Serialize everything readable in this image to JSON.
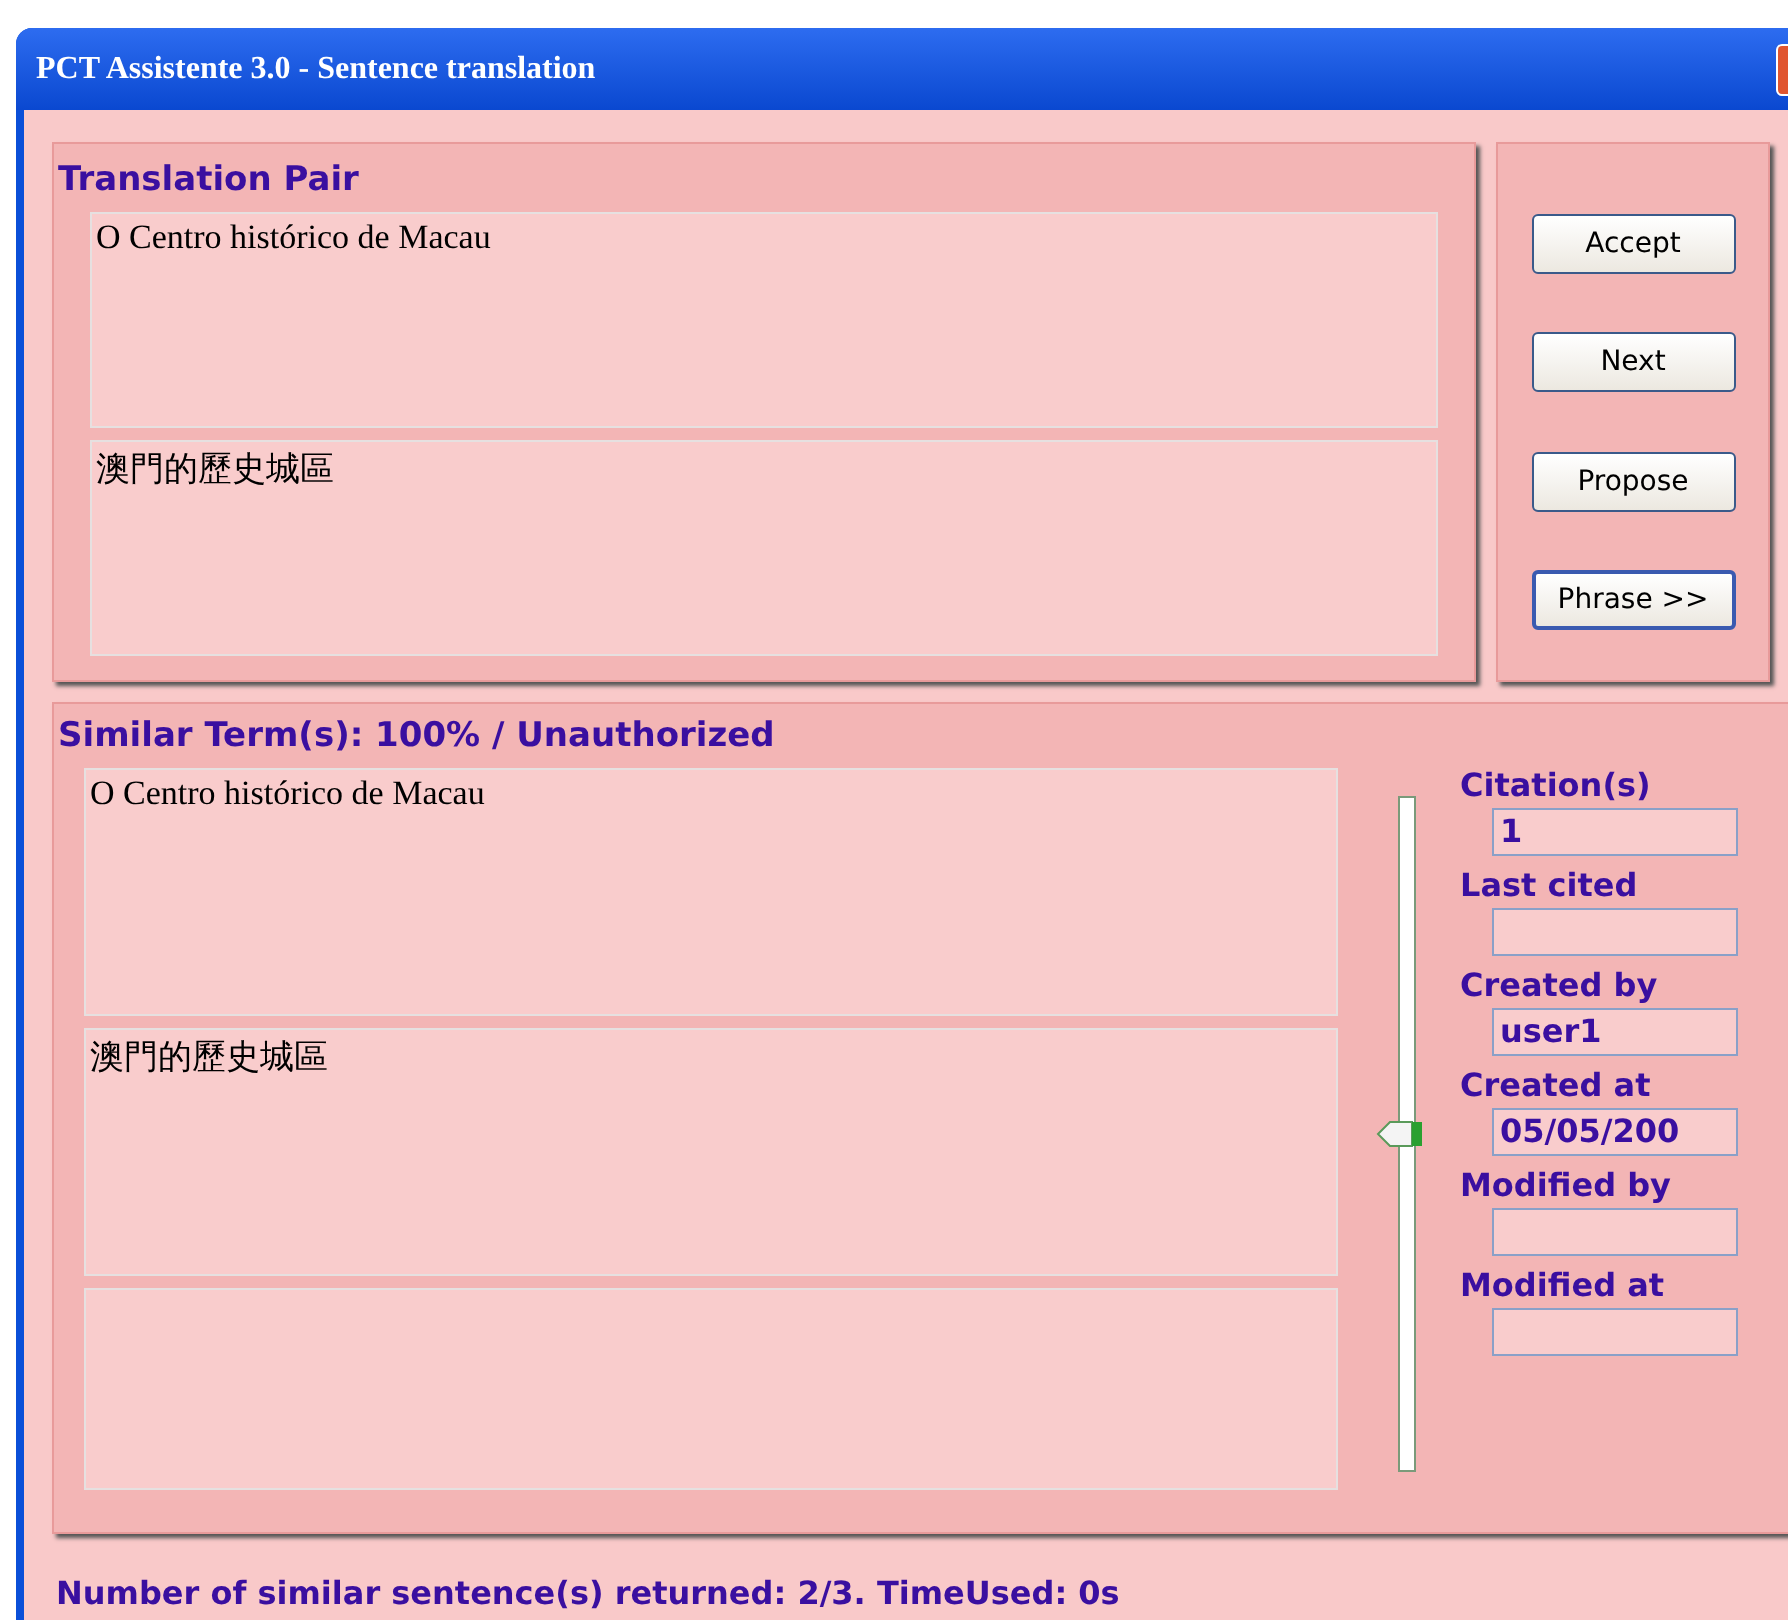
{
  "window": {
    "title": "PCT Assistente 3.0 - Sentence translation"
  },
  "translation_pair": {
    "heading": "Translation Pair",
    "source": "O Centro histórico de Macau",
    "target": "澳門的歷史城區"
  },
  "buttons": [
    {
      "label": "Accept",
      "default": false
    },
    {
      "label": "Next",
      "default": false
    },
    {
      "label": "Propose",
      "default": false
    },
    {
      "label": "Phrase >>",
      "default": true
    }
  ],
  "similar_terms": {
    "heading": "Similar Term(s): 100% / Unauthorized",
    "source": "O Centro histórico de Macau",
    "target": "澳門的歷史城區",
    "slider": {
      "level": 0.5
    },
    "fields": [
      {
        "label": "Citation(s)",
        "value": "1"
      },
      {
        "label": "Last cited"
      },
      {
        "label": "Created by",
        "value": "user1"
      },
      {
        "label": "Created at",
        "value": "05/05/200"
      },
      {
        "label": "Modified by"
      },
      {
        "label": "Modified at"
      }
    ]
  },
  "status_bar": "Number of similar sentence(s) returned: 2/3. TimeUsed: 0s"
}
